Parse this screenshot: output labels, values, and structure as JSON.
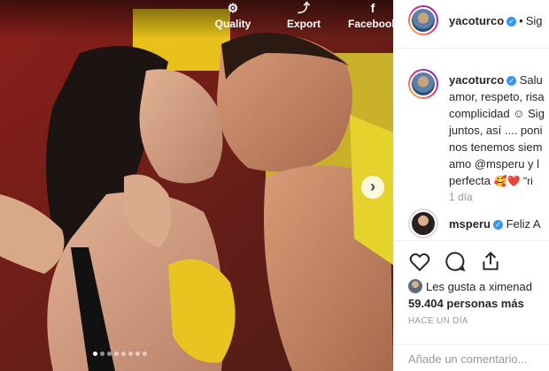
{
  "toolbar": {
    "quality_label": "Quality",
    "export_label": "Export",
    "facebook_label": "Facebook"
  },
  "carousel": {
    "dot_count": 8,
    "active_index": 0
  },
  "header": {
    "username": "yacoturco",
    "separator": "•",
    "follow_label": "Sig"
  },
  "caption": {
    "username": "yacoturco",
    "lines": [
      "Salu",
      "amor, respeto, risa",
      "complicidad ☺ Sig",
      "juntos, así .... poni",
      "nos tenemos siem",
      "amo @msperu y l",
      "perfecta"
    ],
    "emoji_end": "🥰❤️ \"ri",
    "time": "1 día"
  },
  "comment": {
    "username": "msperu",
    "text": "Feliz A"
  },
  "likes": {
    "line1": "Les gusta a ximenad",
    "line2": "59.404 personas más"
  },
  "time_ago": "HACE UN DÍA",
  "add_comment": {
    "placeholder": "Añade un comentario..."
  },
  "colors": {
    "verified": "#3897f0",
    "muted": "#999999",
    "border": "#efefef"
  }
}
